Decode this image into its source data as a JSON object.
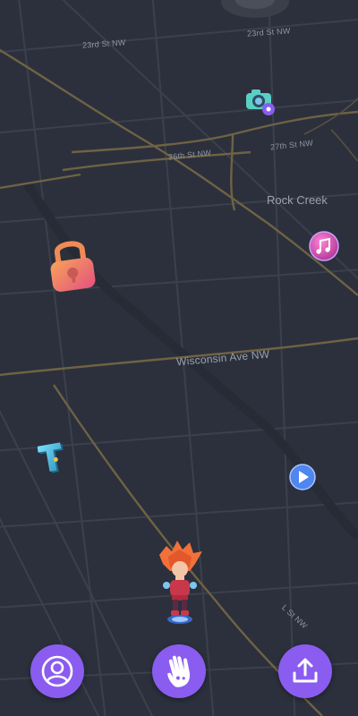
{
  "map": {
    "streets": {
      "s23_top": "23rd St NW",
      "s23_mid": "23rd St NW",
      "s26": "26th St NW",
      "s27": "27th St NW",
      "wisconsin": "Wisconsin Ave NW",
      "bottom_right": "L St NW"
    },
    "areas": {
      "rock_creek": "Rock Creek"
    }
  },
  "pins": [
    {
      "name": "camera-pin",
      "icon": "camera-icon"
    },
    {
      "name": "music-pin",
      "icon": "music-note-icon"
    },
    {
      "name": "lock-pin",
      "icon": "padlock-icon"
    },
    {
      "name": "letter-t-pin",
      "icon": "letter-t-icon",
      "letter": "T"
    },
    {
      "name": "play-pin",
      "icon": "play-icon"
    }
  ],
  "avatar": {
    "icon": "player-avatar-character"
  },
  "bottom_bar": {
    "buttons": [
      {
        "name": "profile-button",
        "icon": "user-icon"
      },
      {
        "name": "wave-button",
        "icon": "hand-icon"
      },
      {
        "name": "share-button",
        "icon": "upload-icon"
      }
    ],
    "accent_color": "#8b5cf0"
  },
  "colors": {
    "map_bg": "#2b303c",
    "major_road": "#7a6a48",
    "minor_road": "#3b4250"
  }
}
